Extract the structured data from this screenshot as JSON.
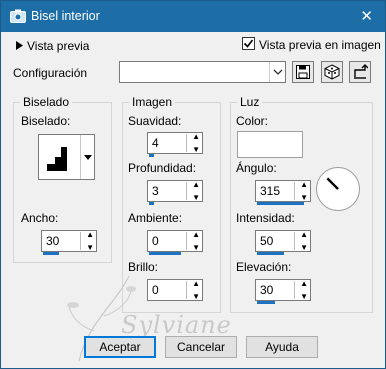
{
  "window": {
    "title": "Bisel interior",
    "close_glyph": "✕"
  },
  "header": {
    "preview_toggle_label": "Vista previa",
    "checkbox_label": "Vista previa en imagen",
    "checkbox_checked": true
  },
  "config": {
    "label": "Configuración",
    "value": ""
  },
  "biselado": {
    "group_title": "Biselado",
    "bevel_label": "Biselado:",
    "width_label": "Ancho:",
    "width_value": "30",
    "width_fill": 0.3
  },
  "imagen": {
    "group_title": "Imagen",
    "suavidad_label": "Suavidad:",
    "suavidad_value": "4",
    "suavidad_fill": 0.1,
    "profundidad_label": "Profundidad:",
    "profundidad_value": "3",
    "profundidad_fill": 0.1,
    "ambiente_label": "Ambiente:",
    "ambiente_value": "0",
    "ambiente_fill": 0.6,
    "brillo_label": "Brillo:",
    "brillo_value": "0",
    "brillo_fill": 0
  },
  "luz": {
    "group_title": "Luz",
    "color_label": "Color:",
    "color_value": "#ffffff",
    "angulo_label": "Ángulo:",
    "angulo_value": "315",
    "angulo_fill": 0.87,
    "intensidad_label": "Intensidad:",
    "intensidad_value": "50",
    "intensidad_fill": 0.5,
    "elevacion_label": "Elevación:",
    "elevacion_value": "30",
    "elevacion_fill": 0.33
  },
  "buttons": {
    "ok": "Aceptar",
    "cancel": "Cancelar",
    "help": "Ayuda"
  },
  "watermark_text": "Sylviane",
  "accent_color": "#1f72c1",
  "titlebar_color": "#1d6ea7",
  "icons": [
    "camera-icon",
    "close-icon",
    "triangle-right-icon",
    "checkbox-check-icon",
    "chevron-down-icon",
    "save-icon",
    "cube-icon",
    "reset-icon",
    "bevel-shape-icon",
    "spin-up-icon",
    "spin-down-icon",
    "angle-dial-icon"
  ]
}
